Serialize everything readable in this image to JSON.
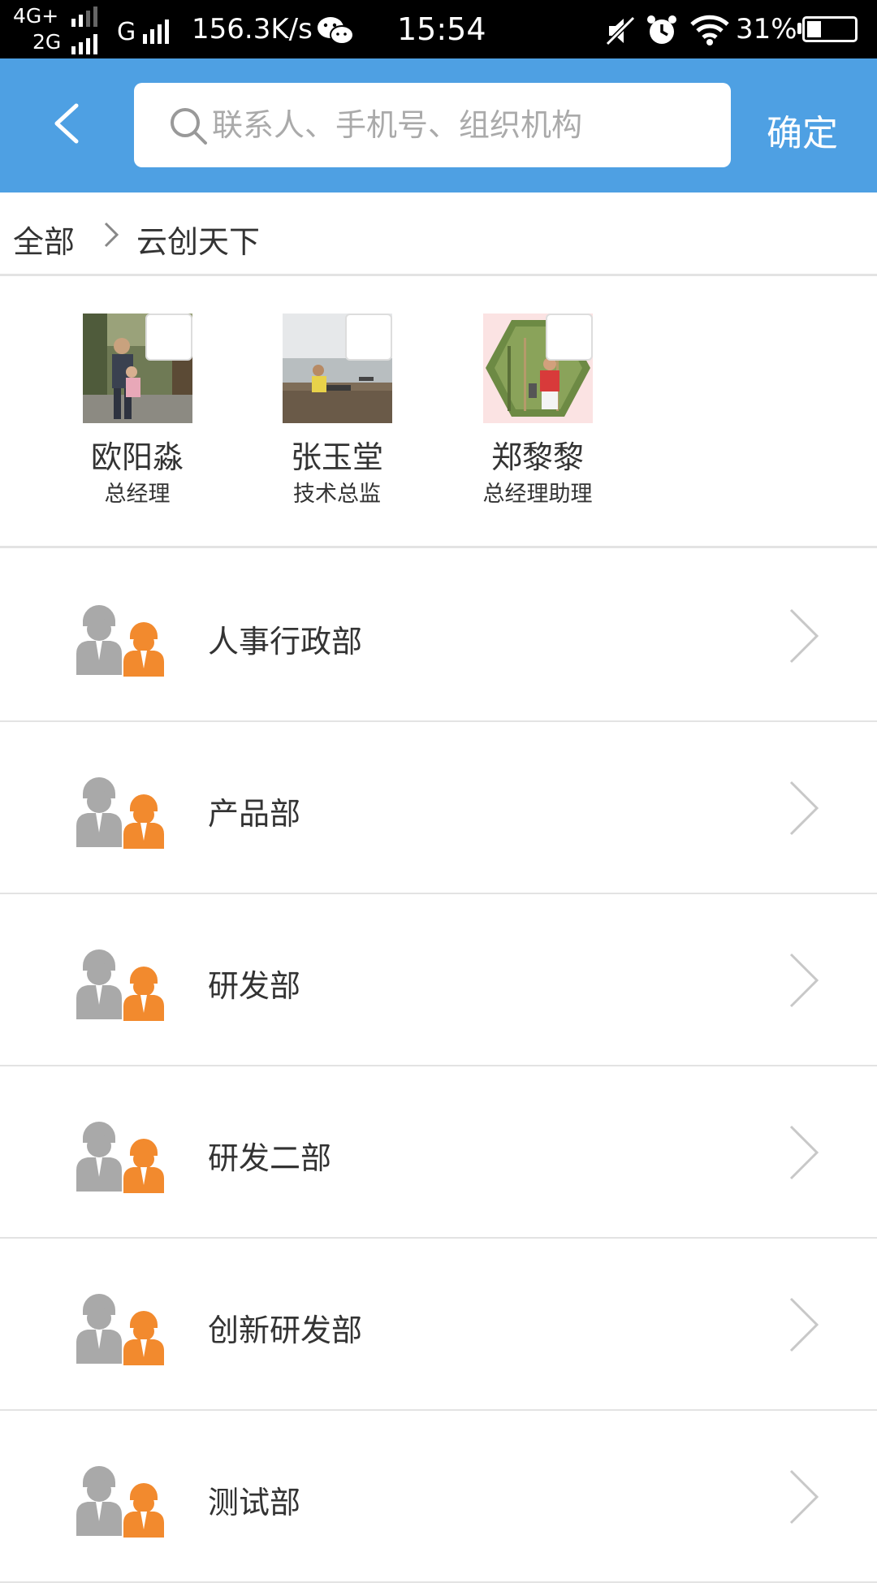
{
  "status_bar": {
    "network_top": "4G+",
    "network_bottom": "2G",
    "carrier_type": "G",
    "speed": "156.3K/s",
    "time": "15:54",
    "battery_pct": "31%",
    "battery_level": 0.31,
    "icons": [
      "signal-icon",
      "wechat-icon",
      "mute-icon",
      "alarm-icon",
      "wifi-icon",
      "battery-icon"
    ]
  },
  "header": {
    "search_placeholder": "联系人、手机号、组织机构",
    "confirm_label": "确定"
  },
  "breadcrumb": {
    "root": "全部",
    "current": "云创天下"
  },
  "people": [
    {
      "name": "欧阳淼",
      "title": "总经理"
    },
    {
      "name": "张玉堂",
      "title": "技术总监"
    },
    {
      "name": "郑黎黎",
      "title": "总经理助理"
    }
  ],
  "departments": [
    {
      "label": "人事行政部"
    },
    {
      "label": "产品部"
    },
    {
      "label": "研发部"
    },
    {
      "label": "研发二部"
    },
    {
      "label": "创新研发部"
    },
    {
      "label": "测试部"
    }
  ],
  "colors": {
    "accent": "#4ea0e3",
    "person_gray": "#a9a9a9",
    "person_orange": "#f28a2e"
  }
}
